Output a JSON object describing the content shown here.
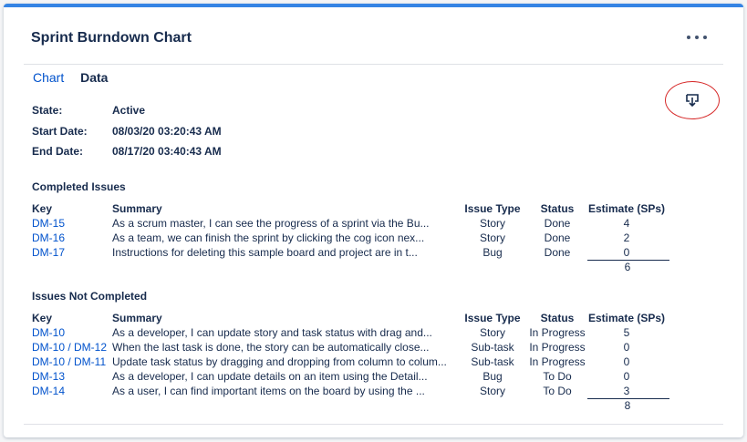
{
  "panel": {
    "title": "Sprint Burndown Chart",
    "more_icon": "more-horizontal-icon"
  },
  "tabs": [
    {
      "label": "Chart",
      "active": false
    },
    {
      "label": "Data",
      "active": true
    }
  ],
  "download": {
    "icon": "download-icon",
    "highlight_color": "#d62828"
  },
  "sprint": {
    "state_label": "State:",
    "state": "Active",
    "start_label": "Start Date:",
    "start": "08/03/20 03:20:43 AM",
    "end_label": "End Date:",
    "end": "08/17/20 03:40:43 AM"
  },
  "columns": {
    "key": "Key",
    "summary": "Summary",
    "type": "Issue Type",
    "status": "Status",
    "estimate": "Estimate (SPs)"
  },
  "completed": {
    "title": "Completed Issues",
    "rows": [
      {
        "key": "DM-15",
        "summary": "As a scrum master, I can see the progress of a sprint via the Bu...",
        "type": "Story",
        "status": "Done",
        "estimate": "4"
      },
      {
        "key": "DM-16",
        "summary": "As a team, we can finish the sprint by clicking the cog icon nex...",
        "type": "Story",
        "status": "Done",
        "estimate": "2"
      },
      {
        "key": "DM-17",
        "summary": "Instructions for deleting this sample board and project are in t...",
        "type": "Bug",
        "status": "Done",
        "estimate": "0"
      }
    ],
    "total": "6"
  },
  "not_completed": {
    "title": "Issues Not Completed",
    "rows": [
      {
        "key": "DM-10",
        "summary": "As a developer, I can update story and task status with drag and...",
        "type": "Story",
        "status": "In Progress",
        "estimate": "5"
      },
      {
        "key": "DM-10 / DM-12",
        "summary": "When the last task is done, the story can be automatically close...",
        "type": "Sub-task",
        "status": "In Progress",
        "estimate": "0"
      },
      {
        "key": "DM-10 / DM-11",
        "summary": "Update task status by dragging and dropping from column to colum...",
        "type": "Sub-task",
        "status": "In Progress",
        "estimate": "0"
      },
      {
        "key": "DM-13",
        "summary": "As a developer, I can update details on an item using the Detail...",
        "type": "Bug",
        "status": "To Do",
        "estimate": "0"
      },
      {
        "key": "DM-14",
        "summary": "As a user, I can find important items on the board by using the ...",
        "type": "Story",
        "status": "To Do",
        "estimate": "3"
      }
    ],
    "total": "8"
  },
  "colors": {
    "link": "#0052cc",
    "text": "#172b4d",
    "accent_border": "#3584e4"
  }
}
